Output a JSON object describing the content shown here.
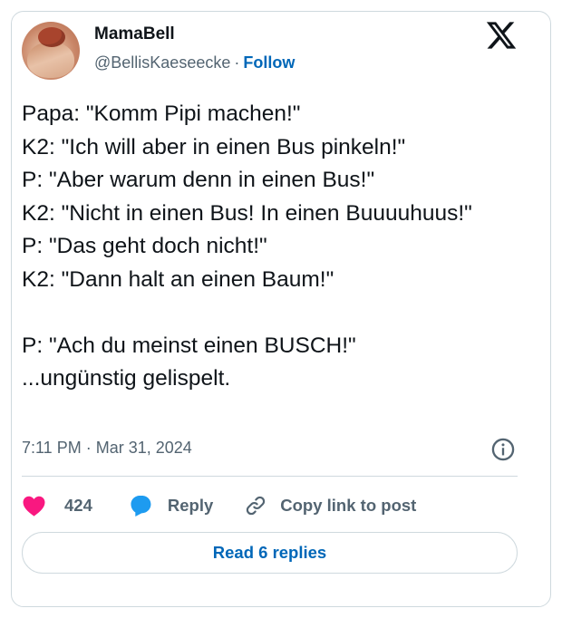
{
  "tweet": {
    "author": {
      "name": "MamaBell",
      "handle": "@BellisKaeseecke",
      "separator": "·",
      "follow_label": "Follow"
    },
    "text": "Papa: \"Komm Pipi machen!\"\nK2: \"Ich will aber in einen Bus pinkeln!\"\nP: \"Aber warum denn in einen Bus!\"\nK2: \"Nicht in einen Bus! In einen Buuuuhuus!\"\nP: \"Das geht doch nicht!\"\nK2: \"Dann halt an einen Baum!\"\n\nP: \"Ach du meinst einen BUSCH!\"\n...ungünstig gelispelt.",
    "timestamp": "7:11 PM · Mar 31, 2024",
    "actions": {
      "like_count": "424",
      "reply_label": "Reply",
      "copy_link_label": "Copy link to post"
    },
    "read_replies_label": "Read 6 replies"
  },
  "icons": {
    "platform_logo": "x-logo-icon",
    "info": "info-icon",
    "like": "heart-icon",
    "reply": "speech-bubble-icon",
    "copy": "link-icon"
  },
  "colors": {
    "text_primary": "#0f1419",
    "text_secondary": "#536471",
    "link_blue": "#0067b8",
    "heart_pink": "#f91880",
    "reply_blue": "#1d9bf0",
    "border": "#cfd9de"
  }
}
